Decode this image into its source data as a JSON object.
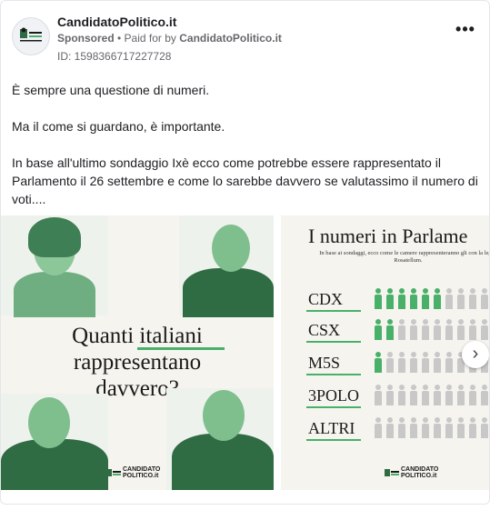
{
  "header": {
    "page_name": "CandidatoPolitico.it",
    "sponsored_label": "Sponsored",
    "paid_for_prefix": " • Paid for by ",
    "paid_for_by": "CandidatoPolitico.it",
    "ad_id": "ID: 1598366717227728",
    "more_icon": "more-horizontal-icon"
  },
  "post": {
    "paragraphs": [
      "È sempre una questione di numeri.",
      "Ma il come si guardano, è importante.",
      "In base all'ultimo sondaggio Ixè ecco come potrebbe essere rappresentato il Parlamento il 26 settembre e come lo sarebbe davvero se valutassimo il numero di voti...."
    ]
  },
  "carousel": {
    "slide1": {
      "headline_line1": "Quanti italiani",
      "headline_line2": "rappresentano",
      "headline_line3": "davvero?",
      "logo_line1": "CANDIDATO",
      "logo_line2": "POLITICO.it"
    },
    "slide2": {
      "title": "I numeri in Parlame",
      "subtitle": "In base ai sondaggi, ecco come le camere rappresenteranno gli con la legge Rosatellum.",
      "rows": [
        {
          "label": "CDX",
          "green": 6
        },
        {
          "label": "CSX",
          "green": 2
        },
        {
          "label": "M5S",
          "green": 1
        },
        {
          "label": "3POLO",
          "green": 0
        },
        {
          "label": "ALTRI",
          "green": 0
        }
      ],
      "logo_line1": "CANDIDATO",
      "logo_line2": "POLITICO.it"
    },
    "next_icon": "chevron-right-icon"
  },
  "colors": {
    "accent_green": "#49b06a",
    "muted_gray": "#c8c8c8"
  }
}
